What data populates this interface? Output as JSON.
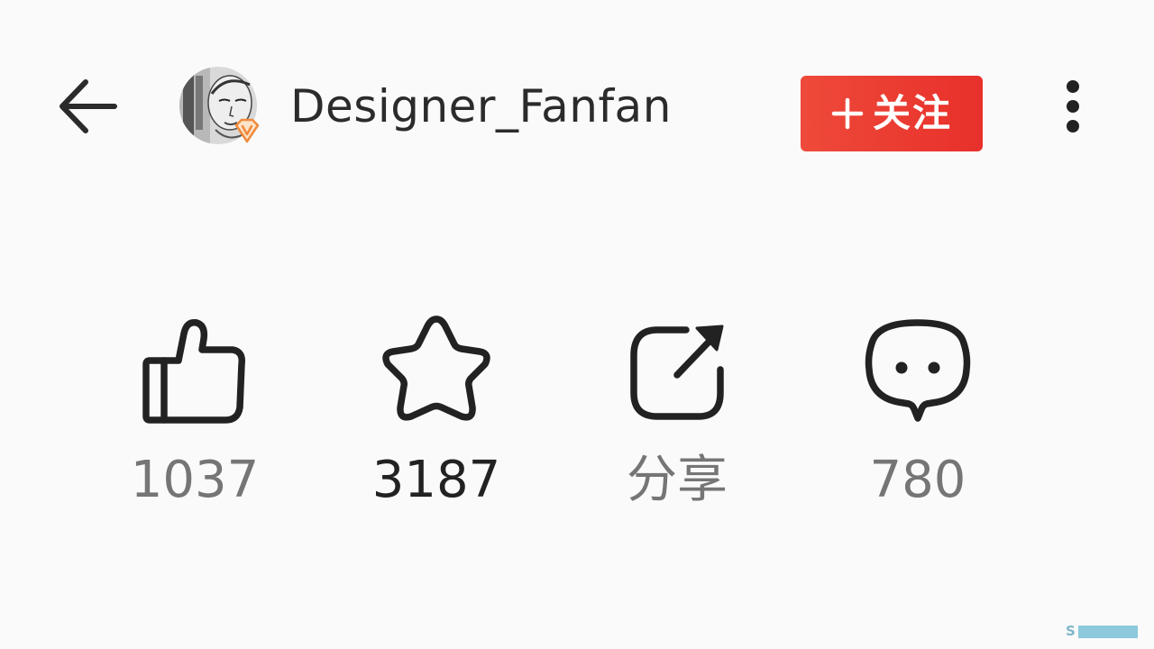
{
  "header": {
    "username": "Designer_Fanfan",
    "follow_label": "关注",
    "icons": {
      "back": "back-arrow-icon",
      "more": "more-vertical-icon",
      "vip": "vip-badge-icon",
      "plus": "plus-icon"
    }
  },
  "actions": {
    "like": {
      "count": "1037",
      "icon": "thumbs-up-icon"
    },
    "favorite": {
      "count": "3187",
      "icon": "star-icon"
    },
    "share": {
      "label": "分享",
      "icon": "share-icon"
    },
    "comment": {
      "count": "780",
      "icon": "comment-icon"
    }
  },
  "watermark": {
    "text": "S"
  },
  "colors": {
    "background": "#fafafa",
    "follow_button": "#e8302b",
    "text_primary": "#2b2b2b",
    "text_muted": "#757575",
    "icon_stroke": "#222222",
    "vip_badge": "#f08a3c"
  }
}
